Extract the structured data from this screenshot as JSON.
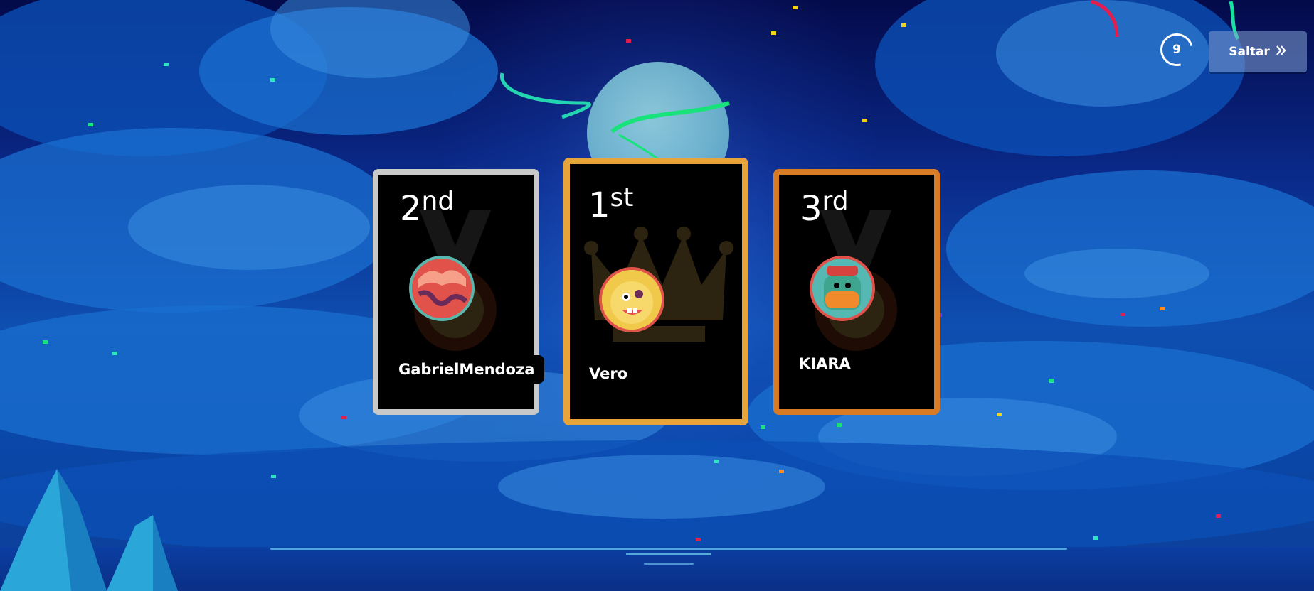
{
  "timer": {
    "seconds": "9"
  },
  "skip_button": {
    "label": "Saltar",
    "icon": "chevrons-right-icon"
  },
  "podium": [
    {
      "place_num": "2",
      "place_suffix": "nd",
      "name": "GabrielMendoza",
      "frame_color": "#c9c9c9",
      "avatar": "red-tentacle-monster-avatar"
    },
    {
      "place_num": "1",
      "place_suffix": "st",
      "name": "Vero",
      "frame_color": "#e6a43a",
      "avatar": "yellow-monster-avatar"
    },
    {
      "place_num": "3",
      "place_suffix": "rd",
      "name": "KIARA",
      "frame_color": "#d97a25",
      "avatar": "green-jar-monster-avatar"
    }
  ],
  "colors": {
    "sky_top": "#040a4a",
    "sky_mid": "#0e4fb0",
    "moon": "#9fe0e6"
  }
}
